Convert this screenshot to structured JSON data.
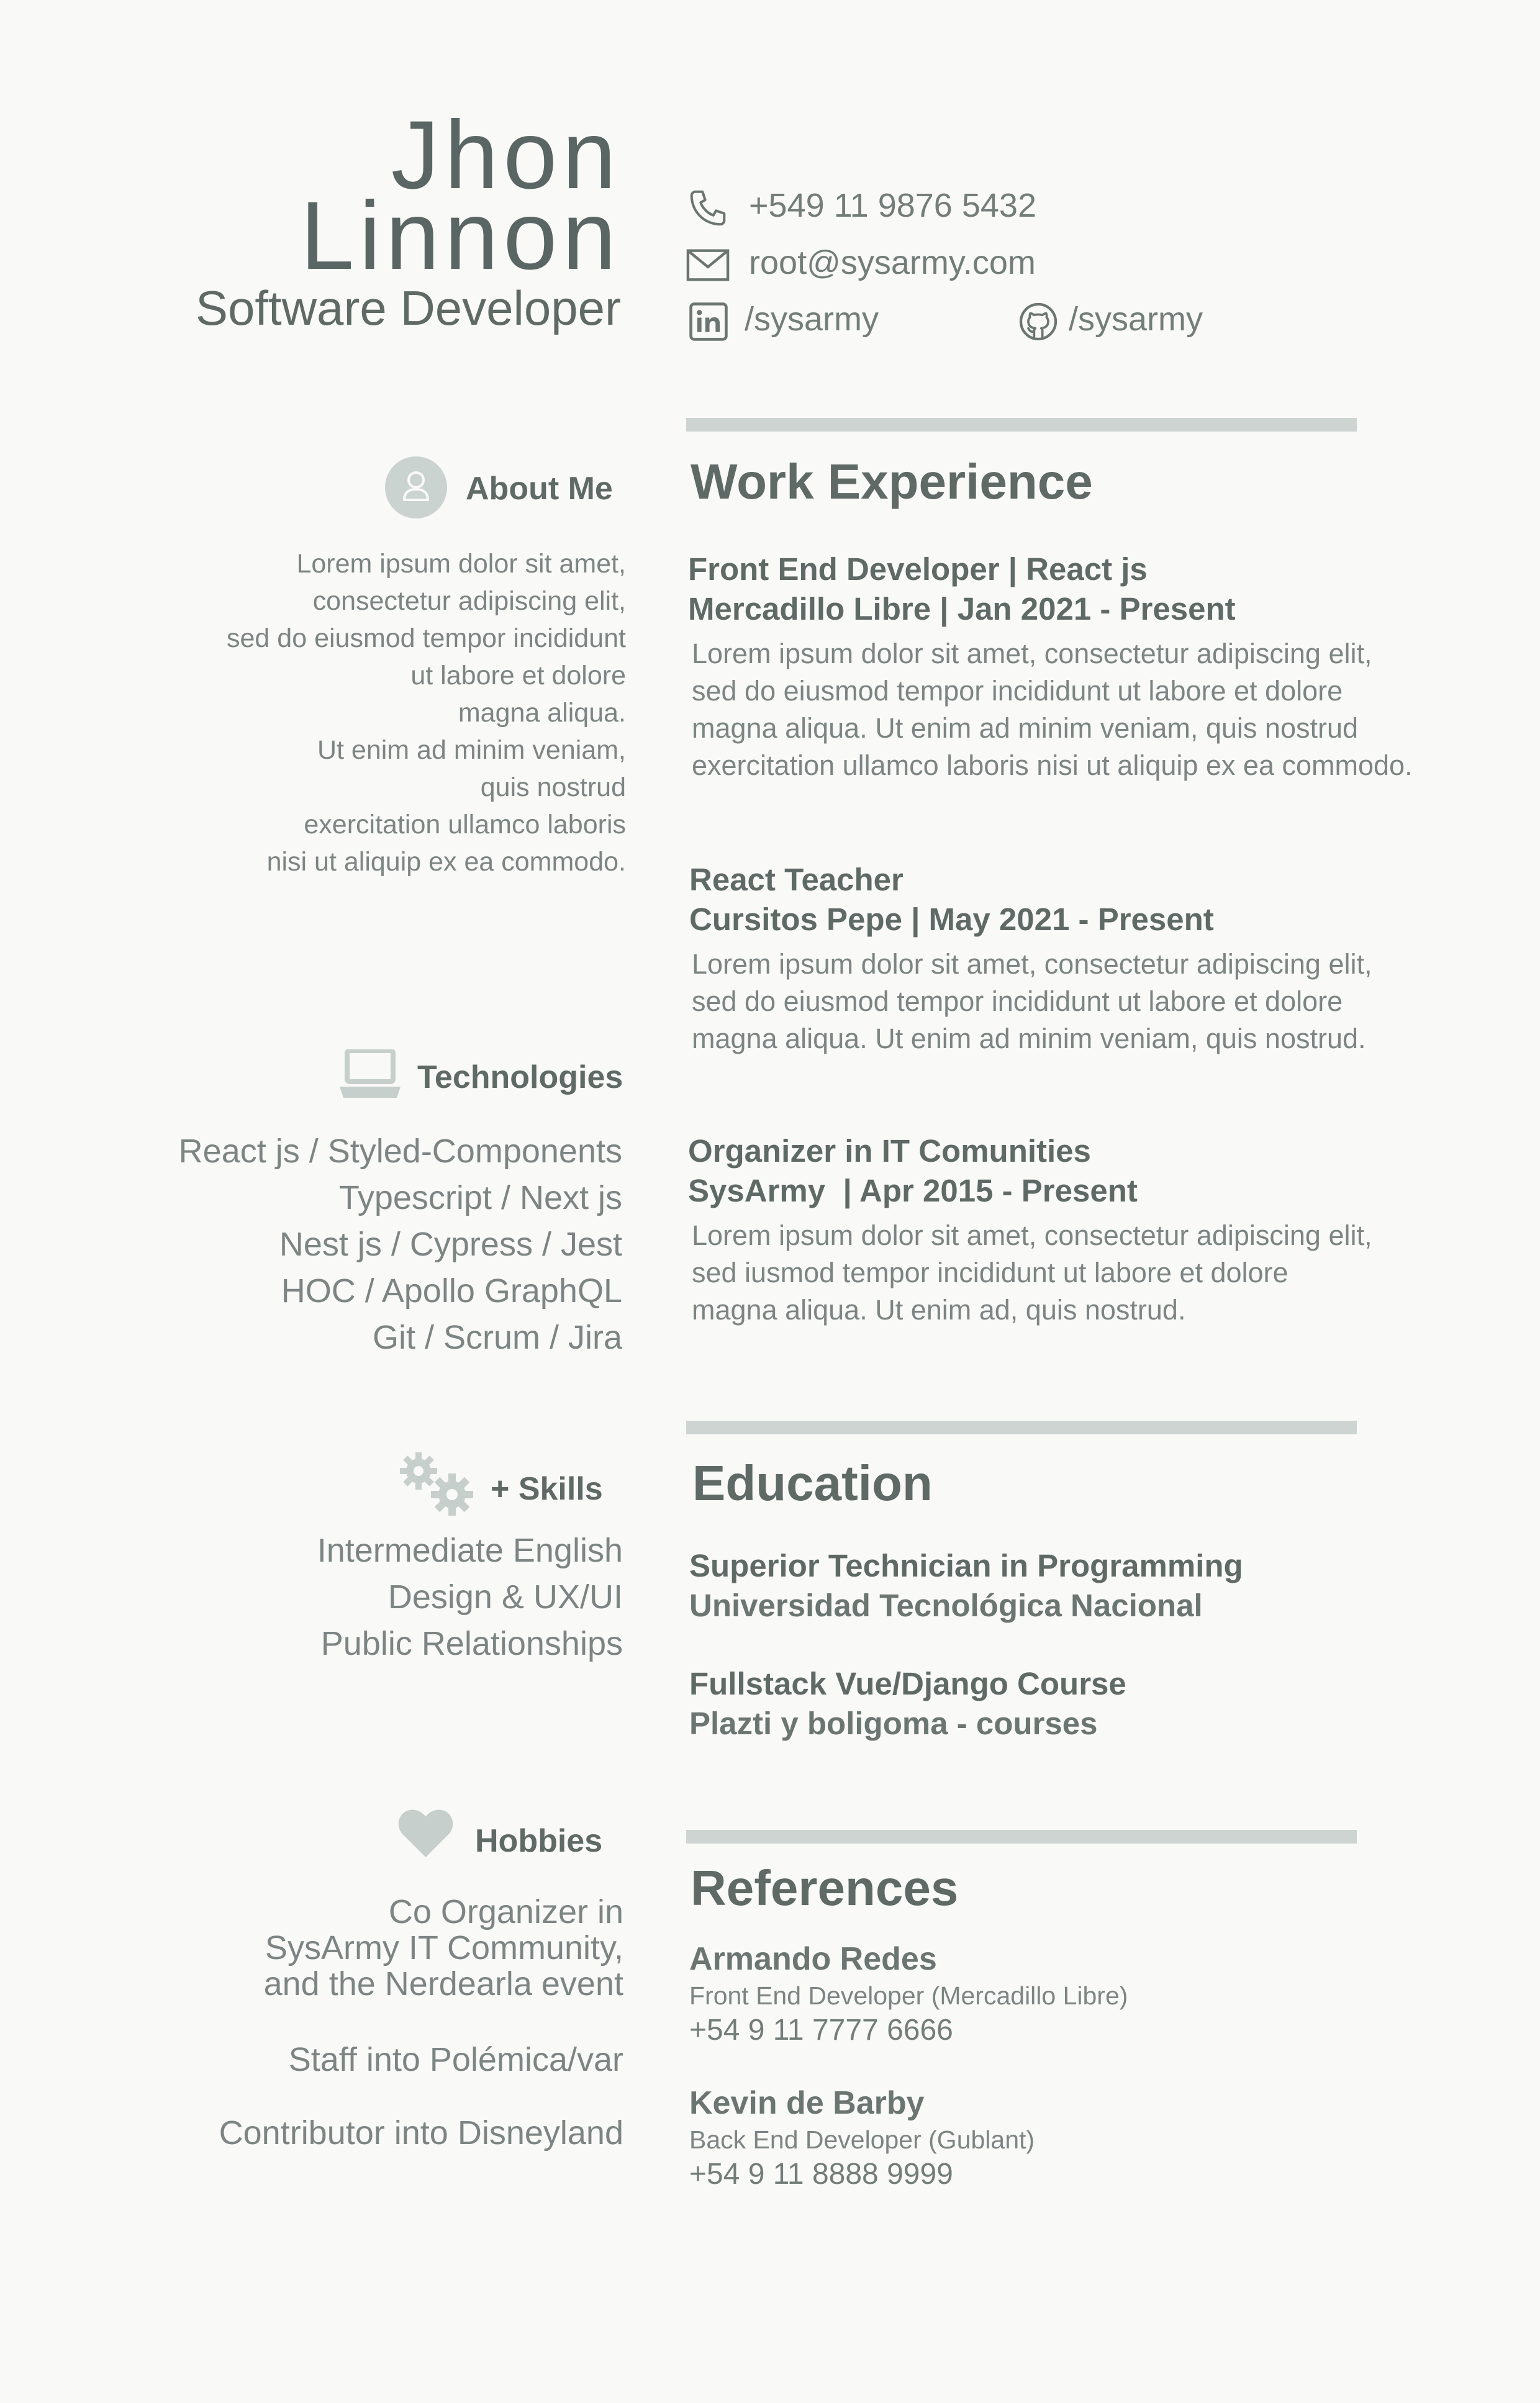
{
  "header": {
    "first_name": "Jhon",
    "last_name": "Linnon",
    "role": "Software Developer"
  },
  "contact": {
    "phone": "+549 11 9876 5432",
    "email": "root@sysarmy.com",
    "linkedin": "/sysarmy",
    "github": "/sysarmy"
  },
  "about": {
    "title": "About Me",
    "lines": [
      "Lorem ipsum dolor sit amet,",
      "consectetur adipiscing elit,",
      "sed do eiusmod tempor incididunt",
      "ut labore et dolore",
      "magna aliqua.",
      "Ut enim ad minim veniam,",
      "quis nostrud",
      "exercitation ullamco laboris",
      "nisi ut aliquip ex ea commodo."
    ]
  },
  "technologies": {
    "title": "Technologies",
    "lines": [
      "React js / Styled-Components",
      "Typescript / Next js",
      "Nest js / Cypress / Jest",
      "HOC / Apollo GraphQL",
      "Git / Scrum / Jira"
    ]
  },
  "skills": {
    "title": "+ Skills",
    "lines": [
      "Intermediate English",
      "Design & UX/UI",
      "Public Relationships"
    ]
  },
  "hobbies": {
    "title": "Hobbies",
    "block1": [
      "Co Organizer in",
      "SysArmy IT Community,",
      "and the Nerdearla event"
    ],
    "item2": "Staff into Polémica/var",
    "item3": "Contributor into Disneyland"
  },
  "work": {
    "title": "Work Experience",
    "jobs": [
      {
        "title": "Front End Developer | React js",
        "company": "Mercadillo Libre | Jan 2021 - Present",
        "desc": [
          "Lorem ipsum dolor sit amet, consectetur adipiscing elit,",
          "sed do eiusmod tempor incididunt ut labore et dolore",
          "magna aliqua. Ut enim ad minim veniam, quis nostrud",
          "exercitation ullamco laboris nisi ut aliquip ex ea commodo."
        ]
      },
      {
        "title": "React Teacher",
        "company": "Cursitos Pepe | May 2021 - Present",
        "desc": [
          "Lorem ipsum dolor sit amet, consectetur adipiscing elit,",
          "sed do eiusmod tempor incididunt ut labore et dolore",
          "magna aliqua. Ut enim ad minim veniam, quis nostrud."
        ]
      },
      {
        "title": "Organizer in IT Comunities",
        "company": "SysArmy  | Apr 2015 - Present",
        "desc": [
          "Lorem ipsum dolor sit amet, consectetur adipiscing elit,",
          "sed iusmod tempor incididunt ut labore et dolore",
          "magna aliqua. Ut enim ad, quis nostrud."
        ]
      }
    ]
  },
  "education": {
    "title": "Education",
    "items": [
      {
        "title": "Superior Technician in Programming",
        "school": "Universidad Tecnológica Nacional"
      },
      {
        "title": "Fullstack Vue/Django Course",
        "school": "Plazti y boligoma - courses"
      }
    ]
  },
  "references": {
    "title": "References",
    "items": [
      {
        "name": "Armando Redes",
        "role": "Front End Developer (Mercadillo Libre)",
        "phone": "+54 9 11 7777 6666"
      },
      {
        "name": "Kevin de Barby",
        "role": "Back End Developer (Gublant)",
        "phone": "+54 9 11 8888 9999"
      }
    ]
  },
  "colors": {
    "background": "#f9f9f8",
    "text": "#5f6a67",
    "muted": "#7c8583",
    "accent_bar": "#cdd4d1"
  }
}
